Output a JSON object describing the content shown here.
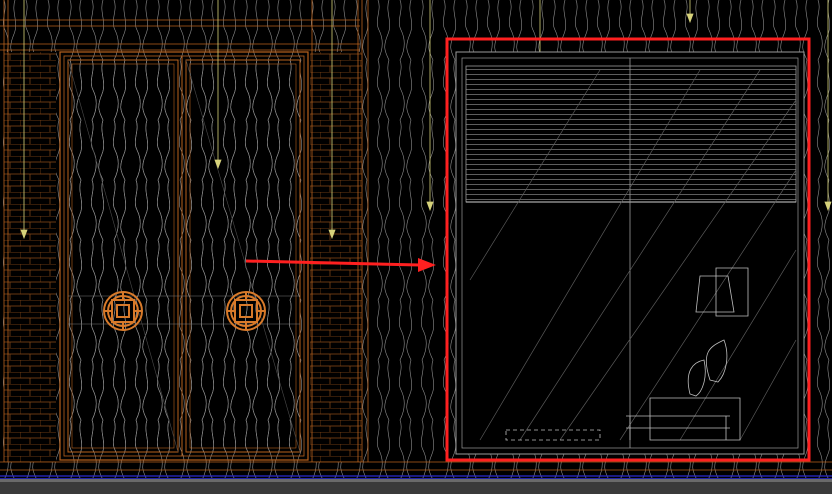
{
  "app": {
    "background_color": "#000000"
  },
  "drawing": {
    "line_colors": {
      "wall_outline": "#b8621d",
      "brick": "#8a4a18",
      "wood_grain": "#9a9a9a",
      "leader": "#d6d27a",
      "glass": "#7a7a7a",
      "highlight_box": "#ff2020",
      "arrow": "#ff2020"
    },
    "elements": {
      "left_double_door": "double-door-elevation",
      "door_ornaments": [
        "round-lattice-ornament-left",
        "round-lattice-ornament-right"
      ],
      "right_window": "window-elevation-with-blind",
      "annotation_box": "red-highlight-box",
      "annotation_arrow": "red-arrow"
    }
  },
  "statusbar": {
    "color": "#3a3a3a"
  }
}
